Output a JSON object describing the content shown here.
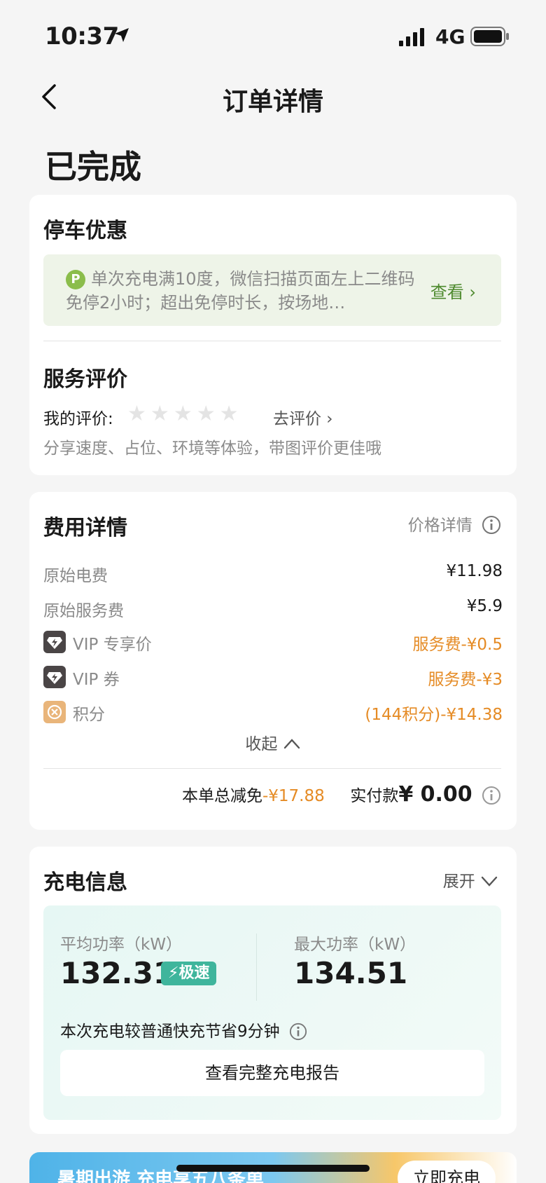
{
  "status_bar": {
    "time": "10:37",
    "network": "4G"
  },
  "nav": {
    "title": "订单详情"
  },
  "order_status": "已完成",
  "parking": {
    "title": "停车优惠",
    "badge": "P",
    "text": "单次充电满10度，微信扫描页面左上二维码免停2小时；超出免停时长，按场地…",
    "view_label": "查看 ›"
  },
  "rating": {
    "title": "服务评价",
    "my_rating_label": "我的评价:",
    "stars": 0,
    "stars_total": 5,
    "go_rate_label": "去评价 ›",
    "hint": "分享速度、占位、环境等体验，带图评价更佳哦"
  },
  "fees": {
    "title": "费用详情",
    "price_detail_label": "价格详情",
    "rows": [
      {
        "label": "原始电费",
        "value": "¥11.98"
      },
      {
        "label": "原始服务费",
        "value": "¥5.9"
      },
      {
        "label": "VIP 专享价",
        "value": "服务费-¥0.5"
      },
      {
        "label": "VIP 券",
        "value": "服务费-¥3"
      },
      {
        "label": "积分",
        "value": "(144积分)-¥14.38"
      }
    ],
    "collapse_label": "收起",
    "total_discount_label": "本单总减免",
    "total_discount_value": "-¥17.88",
    "paid_label": "实付款",
    "paid_value": "¥ 0.00",
    "accent_color": "#e58b25"
  },
  "charging": {
    "title": "充电信息",
    "expand_label": "展开",
    "avg_power_label": "平均功率（kW）",
    "avg_power_value": "132.31",
    "speed_badge": "⚡极速",
    "max_power_label": "最大功率（kW）",
    "max_power_value": "134.51",
    "saving_text": "本次充电较普通快充节省9分钟",
    "report_button": "查看完整充电报告"
  },
  "banner": {
    "text": "暑期出游 充电享五八条单",
    "button": "立即充电"
  }
}
